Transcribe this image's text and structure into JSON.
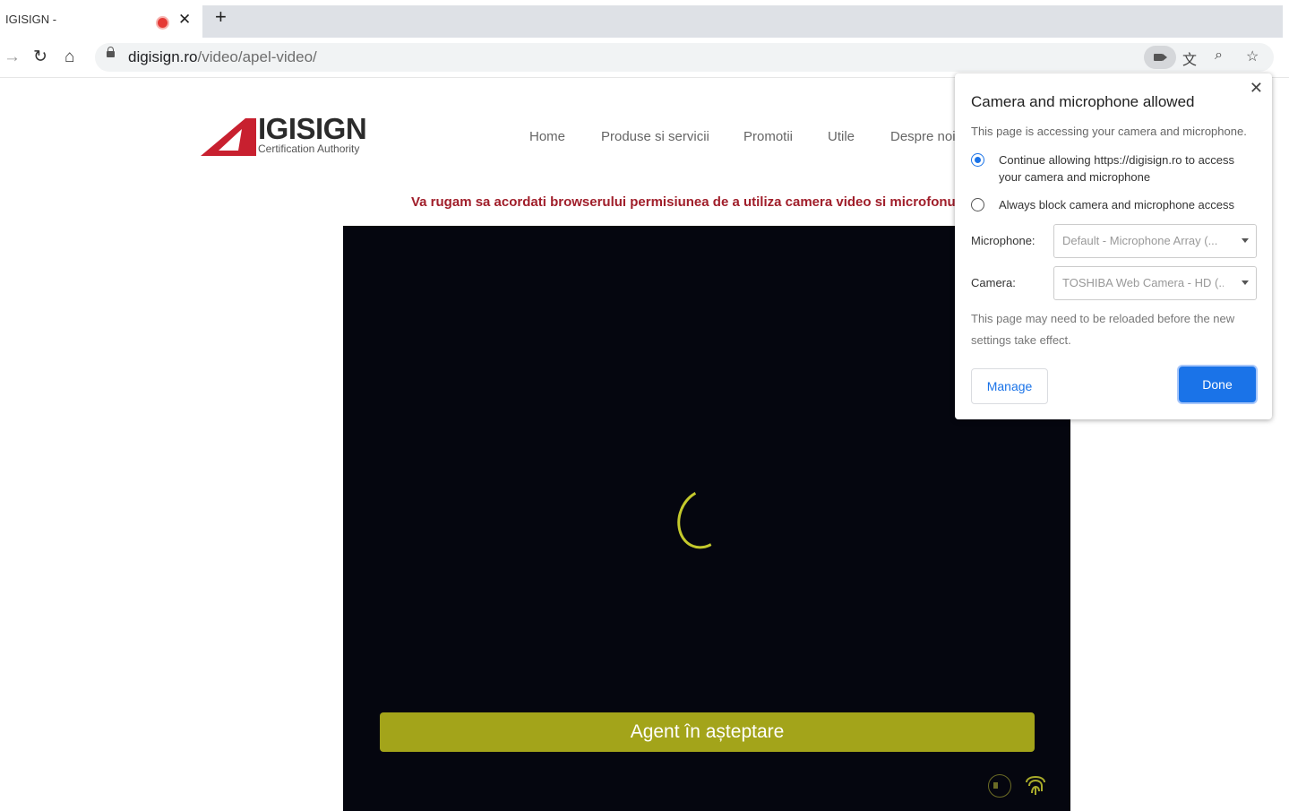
{
  "browser": {
    "tab_title": "IGISIGN -",
    "url_host": "digisign.ro",
    "url_path": "/video/apel-video/"
  },
  "site": {
    "logo_main": "IGISIGN",
    "logo_sub": "Certification Authority",
    "nav": [
      "Home",
      "Produse si servicii",
      "Promotii",
      "Utile",
      "Despre noi"
    ],
    "notice": "Va rugam sa acordati browserului permisiunea de a utiliza camera video si microfonul",
    "agent_status": "Agent în așteptare"
  },
  "popup": {
    "title": "Camera and microphone allowed",
    "description": "This page is accessing your camera and microphone.",
    "option_allow": "Continue allowing https://digisign.ro to access your camera and microphone",
    "option_block": "Always block camera and microphone access",
    "selected_option": "allow",
    "microphone_label": "Microphone:",
    "microphone_value": "Default - Microphone Array (...",
    "camera_label": "Camera:",
    "camera_value": "TOSHIBA Web Camera - HD (...",
    "note": "This page may need to be reloaded before the new settings take effect.",
    "manage_label": "Manage",
    "done_label": "Done"
  },
  "colors": {
    "accent": "#1a73e8",
    "notice": "#a01e2a",
    "agent_bar": "#a3a41a",
    "video_bg": "#05060f"
  }
}
